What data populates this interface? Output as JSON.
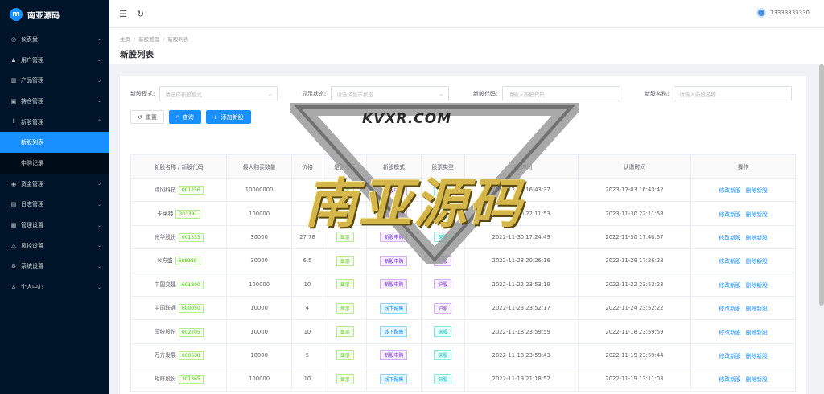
{
  "brand": {
    "name": "南亚源码",
    "logo_letter": "m"
  },
  "sidebar": {
    "items": [
      {
        "label": "仪表盘",
        "icon": "dashboard-icon",
        "glyph": "◎",
        "expanded": false
      },
      {
        "label": "用户管理",
        "icon": "users-icon",
        "glyph": "♟",
        "expanded": false
      },
      {
        "label": "产品管理",
        "icon": "chart-icon",
        "glyph": "▥",
        "expanded": false
      },
      {
        "label": "持仓管理",
        "icon": "position-icon",
        "glyph": "▣",
        "expanded": false
      },
      {
        "label": "新股管理",
        "icon": "ipo-icon",
        "glyph": "⦀",
        "expanded": true
      },
      {
        "label": "资金管理",
        "icon": "wallet-icon",
        "glyph": "◉",
        "expanded": false
      },
      {
        "label": "日志管理",
        "icon": "log-icon",
        "glyph": "▤",
        "expanded": false
      },
      {
        "label": "管理设置",
        "icon": "admin-icon",
        "glyph": "▦",
        "expanded": false
      },
      {
        "label": "风控设置",
        "icon": "warning-icon",
        "glyph": "⚠",
        "expanded": false
      },
      {
        "label": "系统设置",
        "icon": "gear-icon",
        "glyph": "⚙",
        "expanded": false
      },
      {
        "label": "个人中心",
        "icon": "person-icon",
        "glyph": "♙",
        "expanded": false
      }
    ],
    "sub_items": [
      "新股列表",
      "申购记录"
    ]
  },
  "header": {
    "username": "13333333330"
  },
  "breadcrumb": [
    "主页",
    "新股管理",
    "新股列表"
  ],
  "page_title": "新股列表",
  "filters": [
    {
      "label": "新股模式:",
      "placeholder": "请选择新股模式",
      "select": true
    },
    {
      "label": "显示状态:",
      "placeholder": "请选择显示状态",
      "select": true
    },
    {
      "label": "新股代码:",
      "placeholder": "请输入新股代码",
      "select": false
    },
    {
      "label": "新股名称:",
      "placeholder": "请输入新股名称",
      "select": false
    }
  ],
  "buttons": {
    "reset": "重置",
    "search": "查询",
    "add": "添加新股"
  },
  "table": {
    "headers": [
      "新股名称 / 新股代码",
      "最大购买数量",
      "价格",
      "是否显示",
      "新股模式",
      "股票类型",
      "中签时间",
      "认缴时间",
      "操作"
    ],
    "actions": {
      "edit": "修改新股",
      "delete": "删除新股"
    },
    "rows": [
      {
        "name": "纬冈科技",
        "code": "001256",
        "max": "10000000",
        "price": "",
        "show": "显示",
        "mode": "新股申购",
        "type": "深股",
        "win": "2023-12-03 16:43:37",
        "pay": "2023-12-03 16:43:42"
      },
      {
        "name": "卡莱特",
        "code": "301391",
        "max": "100000",
        "price": "",
        "show": "显示",
        "mode": "新股申购",
        "type": "深股",
        "win": "2023-11-30 22:11:53",
        "pay": "2023-11-30 22:11:58"
      },
      {
        "name": "光华股份",
        "code": "001333",
        "max": "30000",
        "price": "27.76",
        "show": "显示",
        "mode": "新股申购",
        "type": "深股",
        "win": "2022-11-30 17:24:49",
        "pay": "2022-11-30 17:40:57"
      },
      {
        "name": "N方盛",
        "code": "688988",
        "max": "30000",
        "price": "6.5",
        "show": "显示",
        "mode": "新股申购",
        "type": "沪股",
        "win": "2022-11-28 20:26:16",
        "pay": "2022-11-28 17:26:23"
      },
      {
        "name": "中国交建",
        "code": "601800",
        "max": "100000",
        "price": "10",
        "show": "显示",
        "mode": "新股申购",
        "type": "沪股",
        "win": "2022-11-22 23:53:19",
        "pay": "2022-11-22 23:53:23"
      },
      {
        "name": "中国联通",
        "code": "600050",
        "max": "10000",
        "price": "4",
        "show": "显示",
        "mode": "线下配售",
        "type": "沪股",
        "win": "2022-11-23 23:52:17",
        "pay": "2022-11-24 23:52:22"
      },
      {
        "name": "国统股份",
        "code": "002205",
        "max": "10000",
        "price": "10",
        "show": "显示",
        "mode": "线下配售",
        "type": "深股",
        "win": "2022-11-18 23:59:59",
        "pay": "2022-11-18 23:59:59"
      },
      {
        "name": "万方发展",
        "code": "000638",
        "max": "10000",
        "price": "5",
        "show": "显示",
        "mode": "新股申购",
        "type": "深股",
        "win": "2022-11-18 23:59:43",
        "pay": "2022-11-19 23:59:44"
      },
      {
        "name": "矩阵股份",
        "code": "301365",
        "max": "100000",
        "price": "10",
        "show": "显示",
        "mode": "线下配售",
        "type": "深股",
        "win": "2022-11-19 21:18:52",
        "pay": "2022-11-19 13:11:03"
      }
    ]
  },
  "watermark": {
    "main": "南亚源码",
    "sub": "KVXR.COM"
  },
  "colors": {
    "sidebar_bg": "#001529",
    "accent": "#1890ff",
    "page_bg": "#f0f2f5"
  }
}
